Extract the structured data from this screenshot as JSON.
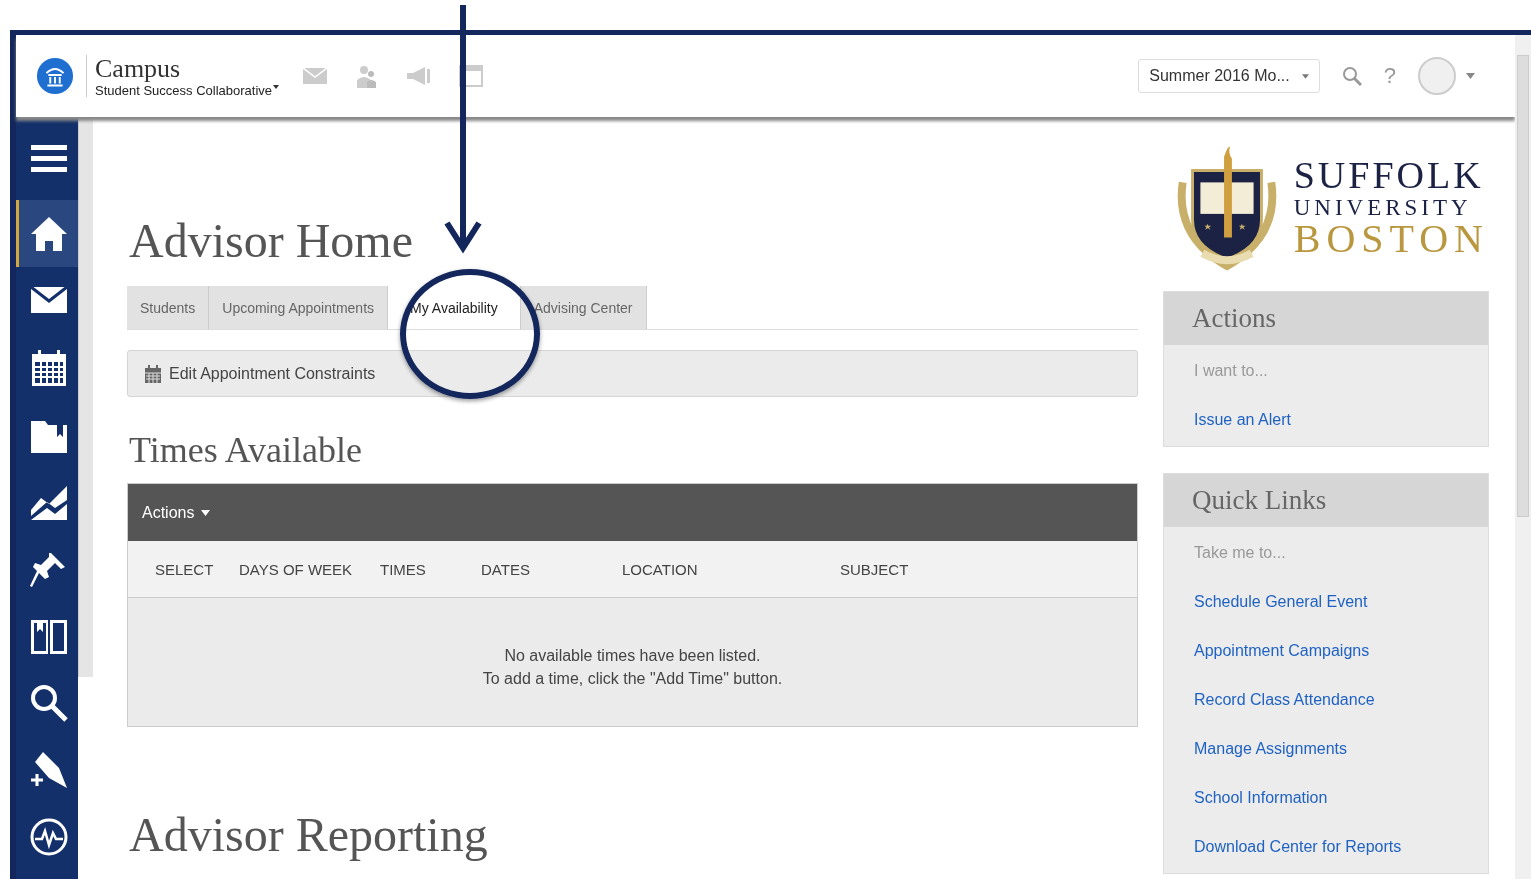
{
  "header": {
    "app_name": "Campus",
    "app_subtitle": "Student Success Collaborative",
    "term_select": {
      "value": "Summer 2016 Mo..."
    },
    "help": "?"
  },
  "sidebar": {
    "items": [
      {
        "selected": false
      },
      {
        "selected": true
      },
      {
        "selected": false
      },
      {
        "selected": false
      },
      {
        "selected": false
      },
      {
        "selected": false
      },
      {
        "selected": false
      },
      {
        "selected": false
      },
      {
        "selected": false
      },
      {
        "selected": false
      },
      {
        "selected": false
      }
    ]
  },
  "page_title": "Advisor Home",
  "tabs": [
    {
      "label": "Students",
      "selected": false
    },
    {
      "label": "Upcoming Appointments",
      "selected": false
    },
    {
      "label": "My Availability",
      "selected": true
    },
    {
      "label": "Advising Center",
      "selected": false
    }
  ],
  "toolbar": {
    "button": "Edit Appointment Constraints"
  },
  "times_available": {
    "title": "Times Available",
    "actions": "Actions",
    "columns": [
      "SELECT",
      "DAYS OF WEEK",
      "TIMES",
      "DATES",
      "LOCATION",
      "SUBJECT"
    ],
    "empty_message": [
      "No available times have been listed.",
      "To add a time, click the \"Add Time\" button."
    ]
  },
  "reporting": {
    "title": "Advisor Reporting"
  },
  "logo": {
    "line_1": "SUFFOLK",
    "line_2": "UNIVERSITY",
    "line_3": "BOSTON"
  },
  "panels": [
    {
      "title": "Actions",
      "hint": "I want to...",
      "links": [
        "Issue an Alert"
      ]
    },
    {
      "title": "Quick Links",
      "hint": "Take me to...",
      "links": [
        "Schedule General Event",
        "Appointment Campaigns",
        "Record Class Attendance",
        "Manage Assignments",
        "School Information",
        "Download Center for Reports"
      ]
    }
  ]
}
